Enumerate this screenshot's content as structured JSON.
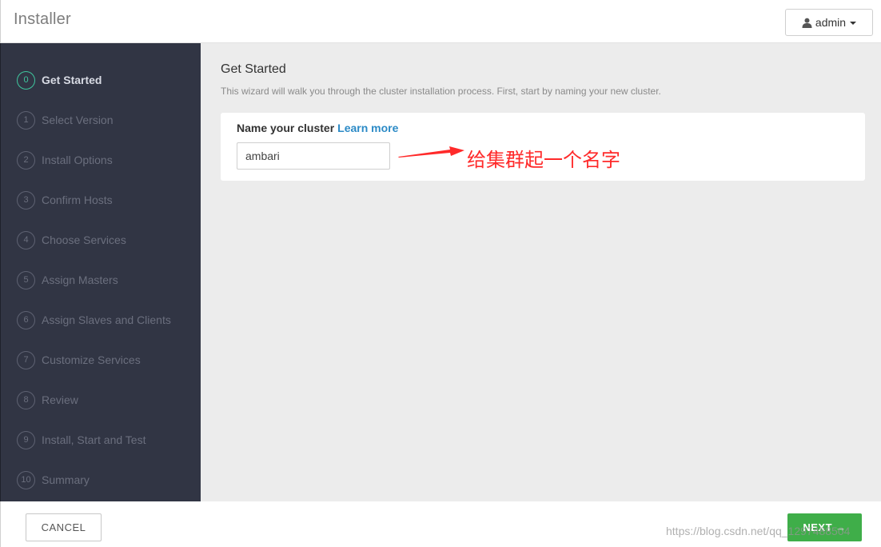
{
  "header": {
    "app_title": "Installer",
    "user_label": "admin",
    "user_icon": "user-icon",
    "caret_icon": "caret-down-icon"
  },
  "sidebar": {
    "steps": [
      {
        "number": "0",
        "label": "Get Started",
        "active": true
      },
      {
        "number": "1",
        "label": "Select Version",
        "active": false
      },
      {
        "number": "2",
        "label": "Install Options",
        "active": false
      },
      {
        "number": "3",
        "label": "Confirm Hosts",
        "active": false
      },
      {
        "number": "4",
        "label": "Choose Services",
        "active": false
      },
      {
        "number": "5",
        "label": "Assign Masters",
        "active": false
      },
      {
        "number": "6",
        "label": "Assign Slaves and Clients",
        "active": false
      },
      {
        "number": "7",
        "label": "Customize Services",
        "active": false
      },
      {
        "number": "8",
        "label": "Review",
        "active": false
      },
      {
        "number": "9",
        "label": "Install, Start and Test",
        "active": false
      },
      {
        "number": "10",
        "label": "Summary",
        "active": false
      }
    ]
  },
  "main": {
    "title": "Get Started",
    "description": "This wizard will walk you through the cluster installation process. First, start by naming your new cluster.",
    "field_label": "Name your cluster",
    "learn_more": "Learn more",
    "cluster_name_value": "ambari"
  },
  "annotation": {
    "text": "给集群起一个名字",
    "color": "#ff2a2a"
  },
  "footer": {
    "cancel_label": "CANCEL",
    "next_label": "NEXT →",
    "watermark": "https://blog.csdn.net/qq_1297488504"
  },
  "colors": {
    "sidebar_bg": "#313544",
    "active_step": "#3fc69e",
    "next_button": "#3fae49",
    "link": "#2b8ac6"
  }
}
